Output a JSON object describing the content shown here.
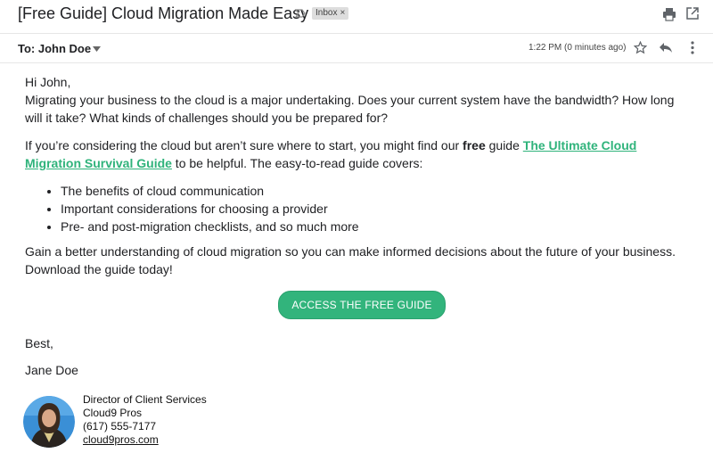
{
  "email": {
    "subject": "[Free Guide] Cloud Migration Made Easy",
    "label": "Inbox",
    "label_remove": "×"
  },
  "header": {
    "to_line": "To: John Doe",
    "time": "1:22 PM (0 minutes ago)"
  },
  "icons": {
    "important": "important-marker-icon",
    "print": "print-icon",
    "popout": "open-in-new-window-icon",
    "caret": "chevron-down-icon",
    "star": "star-icon",
    "reply": "reply-icon",
    "more": "more-vert-icon"
  },
  "body": {
    "greeting": "Hi John,",
    "intro": "Migrating your business to the cloud is a major undertaking. Does your current system have the bandwidth? How long will it take? What kinds of challenges should you be prepared for?",
    "p2_before": "If you’re considering the cloud but aren’t sure where to start, you might find our ",
    "p2_bold": "free",
    "p2_mid": " guide ",
    "p2_link": "The Ultimate Cloud Migration Survival Guide",
    "p2_after": " to be helpful. The easy-to-read guide covers:",
    "bullets": [
      "The benefits of cloud communication",
      "Important considerations for choosing a provider",
      "Pre- and post-migration checklists, and so much more"
    ],
    "p3": "Gain a better understanding of cloud migration so you can make informed decisions about the future of your business. Download the guide today!",
    "cta": "ACCESS THE FREE GUIDE",
    "closing": "Best,",
    "sender": "Jane Doe"
  },
  "signature": {
    "title": "Director of Client Services",
    "company": "Cloud9 Pros",
    "phone": "(617) 555-7177",
    "website": "cloud9pros.com"
  },
  "colors": {
    "accent_green": "#32b47c",
    "link_green": "#2fb37b"
  }
}
